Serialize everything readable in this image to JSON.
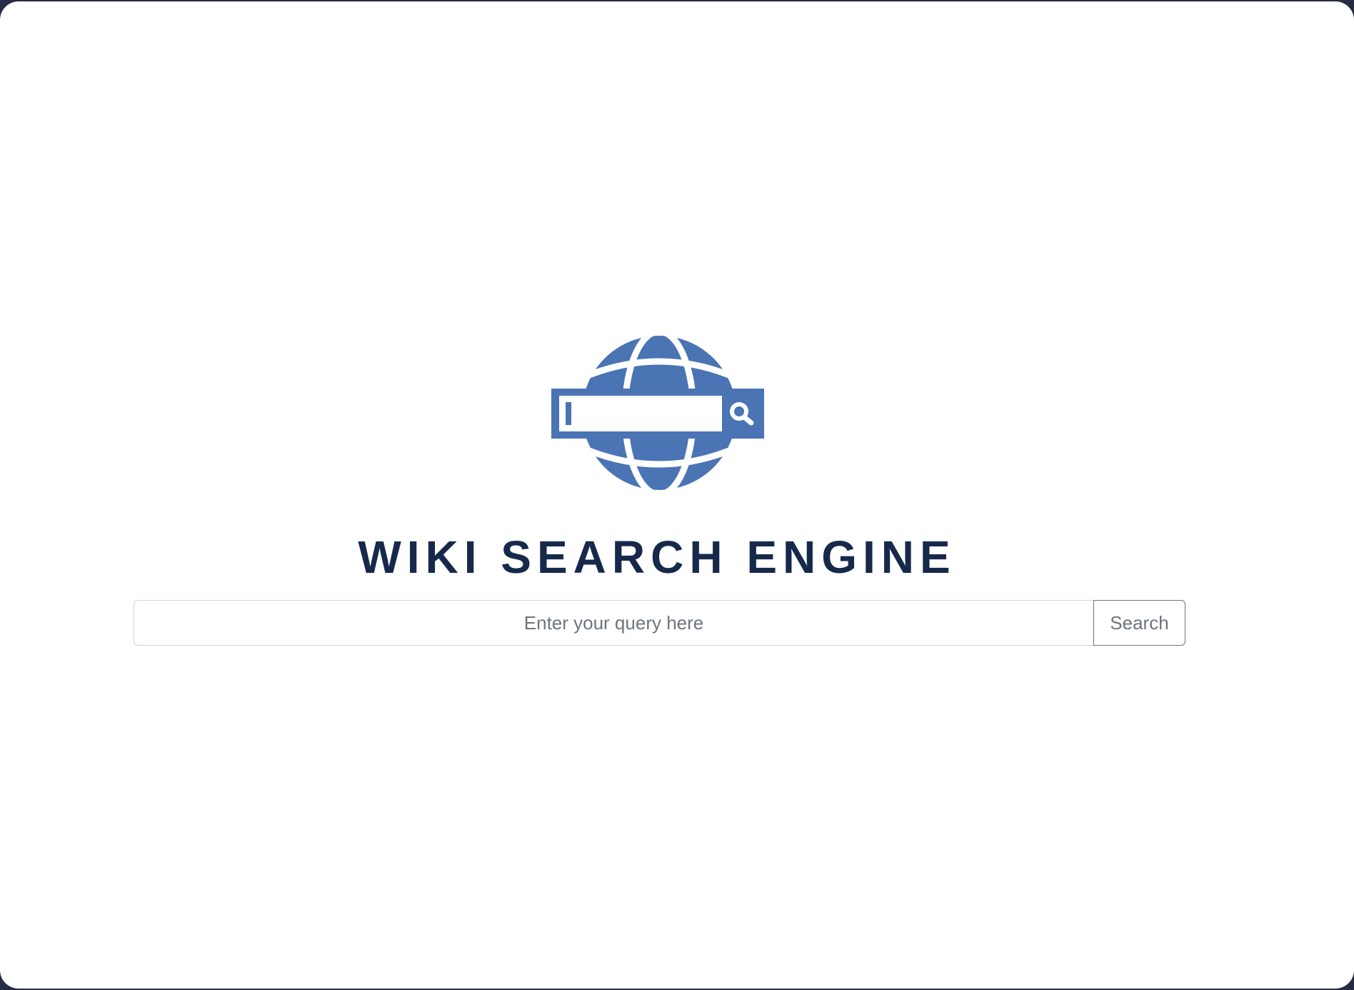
{
  "logo": {
    "icon": "globe-search-icon",
    "color": "#4a74b4"
  },
  "title": "WIKI SEARCH ENGINE",
  "search": {
    "placeholder": "Enter your query here",
    "value": "",
    "button_label": "Search"
  },
  "colors": {
    "title": "#16294b",
    "accent": "#4a74b4",
    "backdrop": "#272c45"
  }
}
